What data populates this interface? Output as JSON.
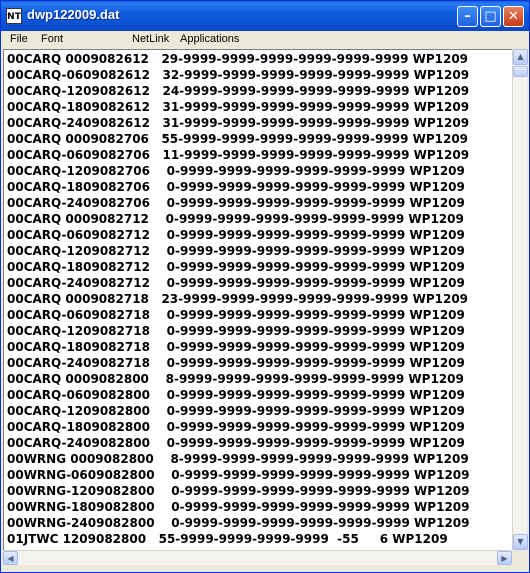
{
  "window": {
    "title": "dwp122009.dat",
    "icon_label": "NT"
  },
  "menu": {
    "file": "File",
    "font": "Font",
    "netlink": "NetLink",
    "applications": "Applications"
  },
  "titlebar_buttons": {
    "minimize": "–",
    "maximize": "□",
    "close": "✕"
  },
  "lines": [
    "00CARQ 0009082612   29-9999-9999-9999-9999-9999-9999 WP1209",
    "00CARQ-0609082612   32-9999-9999-9999-9999-9999-9999 WP1209",
    "00CARQ-1209082612   24-9999-9999-9999-9999-9999-9999 WP1209",
    "00CARQ-1809082612   31-9999-9999-9999-9999-9999-9999 WP1209",
    "00CARQ-2409082612   31-9999-9999-9999-9999-9999-9999 WP1209",
    "00CARQ 0009082706   55-9999-9999-9999-9999-9999-9999 WP1209",
    "00CARQ-0609082706   11-9999-9999-9999-9999-9999-9999 WP1209",
    "00CARQ-1209082706    0-9999-9999-9999-9999-9999-9999 WP1209",
    "00CARQ-1809082706    0-9999-9999-9999-9999-9999-9999 WP1209",
    "00CARQ-2409082706    0-9999-9999-9999-9999-9999-9999 WP1209",
    "00CARQ 0009082712    0-9999-9999-9999-9999-9999-9999 WP1209",
    "00CARQ-0609082712    0-9999-9999-9999-9999-9999-9999 WP1209",
    "00CARQ-1209082712    0-9999-9999-9999-9999-9999-9999 WP1209",
    "00CARQ-1809082712    0-9999-9999-9999-9999-9999-9999 WP1209",
    "00CARQ-2409082712    0-9999-9999-9999-9999-9999-9999 WP1209",
    "00CARQ 0009082718   23-9999-9999-9999-9999-9999-9999 WP1209",
    "00CARQ-0609082718    0-9999-9999-9999-9999-9999-9999 WP1209",
    "00CARQ-1209082718    0-9999-9999-9999-9999-9999-9999 WP1209",
    "00CARQ-1809082718    0-9999-9999-9999-9999-9999-9999 WP1209",
    "00CARQ-2409082718    0-9999-9999-9999-9999-9999-9999 WP1209",
    "00CARQ 0009082800    8-9999-9999-9999-9999-9999-9999 WP1209",
    "00CARQ-0609082800    0-9999-9999-9999-9999-9999-9999 WP1209",
    "00CARQ-1209082800    0-9999-9999-9999-9999-9999-9999 WP1209",
    "00CARQ-1809082800    0-9999-9999-9999-9999-9999-9999 WP1209",
    "00CARQ-2409082800    0-9999-9999-9999-9999-9999-9999 WP1209",
    "00WRNG 0009082800    8-9999-9999-9999-9999-9999-9999 WP1209",
    "00WRNG-0609082800    0-9999-9999-9999-9999-9999-9999 WP1209",
    "00WRNG-1209082800    0-9999-9999-9999-9999-9999-9999 WP1209",
    "00WRNG-1809082800    0-9999-9999-9999-9999-9999-9999 WP1209",
    "00WRNG-2409082800    0-9999-9999-9999-9999-9999-9999 WP1209",
    "01JTWC 1209082800   55-9999-9999-9999-9999  -55     6 WP1209"
  ],
  "scrollbar": {
    "up": "▲",
    "down": "▼",
    "left": "◀",
    "right": "▶"
  }
}
